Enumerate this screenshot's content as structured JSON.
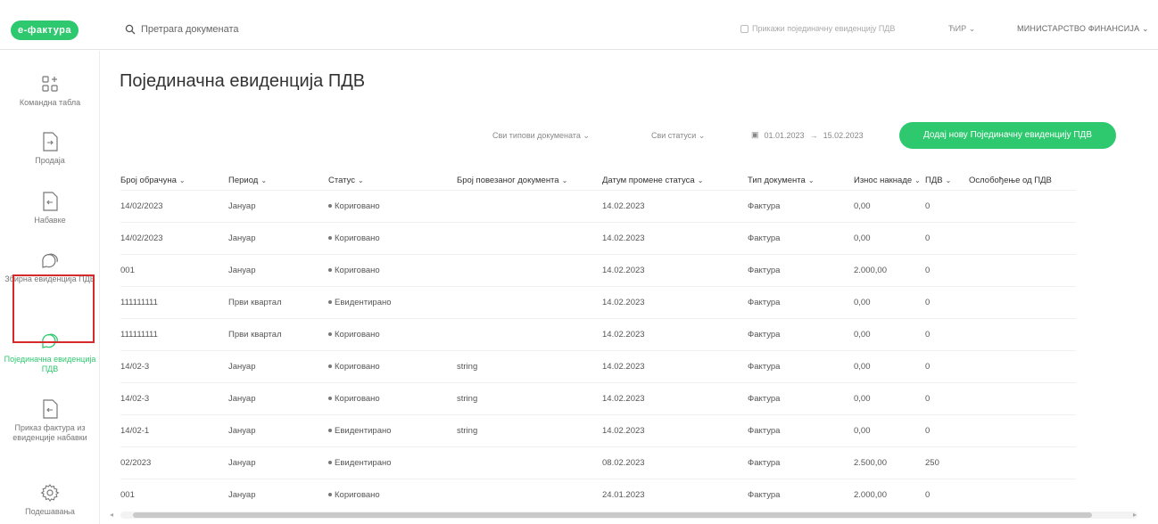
{
  "app": {
    "logo": "е-фактура"
  },
  "search": {
    "placeholder": "Претрага докумената"
  },
  "topbar": {
    "checkbox_label": "Прикажи појединачну евиденцију ПДВ",
    "language": "ЋИР",
    "organization": "МИНИСТАРСТВО ФИНАНСИЈА"
  },
  "sidebar": {
    "items": [
      {
        "label": "Командна табла",
        "icon": "dashboard-icon"
      },
      {
        "label": "Продаја",
        "icon": "document-out-icon"
      },
      {
        "label": "Набавке",
        "icon": "document-in-icon"
      },
      {
        "label": "Збирна евиденција ПДВ",
        "icon": "chat-icon"
      },
      {
        "label": "Појединачна евиденција ПДВ",
        "icon": "chat-icon"
      },
      {
        "label": "Приказ фактура из евиденције набавки",
        "icon": "document-in-icon"
      },
      {
        "label": "Подешавања",
        "icon": "gear-icon"
      }
    ]
  },
  "page": {
    "title": "Појединачна евиденција ПДВ",
    "filters": {
      "document_type": "Сви типови докумената",
      "status": "Сви статуси",
      "date_from": "01.01.2023",
      "date_to": "15.02.2023"
    },
    "add_button": "Додај нову Појединачну евиденцију ПДВ"
  },
  "table": {
    "columns": [
      "Број обрачуна",
      "Период",
      "Статус",
      "Број повезаног документа",
      "Датум промене статуса",
      "Тип документа",
      "Износ накнаде",
      "ПДВ",
      "Ослобођење од ПДВ"
    ],
    "rows": [
      [
        "14/02/2023",
        "Јануар",
        "Коригованo",
        "",
        "14.02.2023",
        "Фактура",
        "0,00",
        "0",
        ""
      ],
      [
        "14/02/2023",
        "Јануар",
        "Коригованo",
        "",
        "14.02.2023",
        "Фактура",
        "0,00",
        "0",
        ""
      ],
      [
        "001",
        "Јануар",
        "Коригованo",
        "",
        "14.02.2023",
        "Фактура",
        "2.000,00",
        "0",
        ""
      ],
      [
        "111111111",
        "Први квартал",
        "Евидентирано",
        "",
        "14.02.2023",
        "Фактура",
        "0,00",
        "0",
        ""
      ],
      [
        "111111111",
        "Први квартал",
        "Коригованo",
        "",
        "14.02.2023",
        "Фактура",
        "0,00",
        "0",
        ""
      ],
      [
        "14/02-3",
        "Јануар",
        "Коригованo",
        "string",
        "14.02.2023",
        "Фактура",
        "0,00",
        "0",
        ""
      ],
      [
        "14/02-3",
        "Јануар",
        "Коригованo",
        "string",
        "14.02.2023",
        "Фактура",
        "0,00",
        "0",
        ""
      ],
      [
        "14/02-1",
        "Јануар",
        "Евидентирано",
        "string",
        "14.02.2023",
        "Фактура",
        "0,00",
        "0",
        ""
      ],
      [
        "02/2023",
        "Јануар",
        "Евидентирано",
        "",
        "08.02.2023",
        "Фактура",
        "2.500,00",
        "250",
        ""
      ],
      [
        "001",
        "Јануар",
        "Коригованo",
        "",
        "24.01.2023",
        "Фактура",
        "2.000,00",
        "0",
        ""
      ]
    ]
  },
  "colors": {
    "accent": "#2ec86e",
    "highlight_border": "#d42a2a"
  }
}
